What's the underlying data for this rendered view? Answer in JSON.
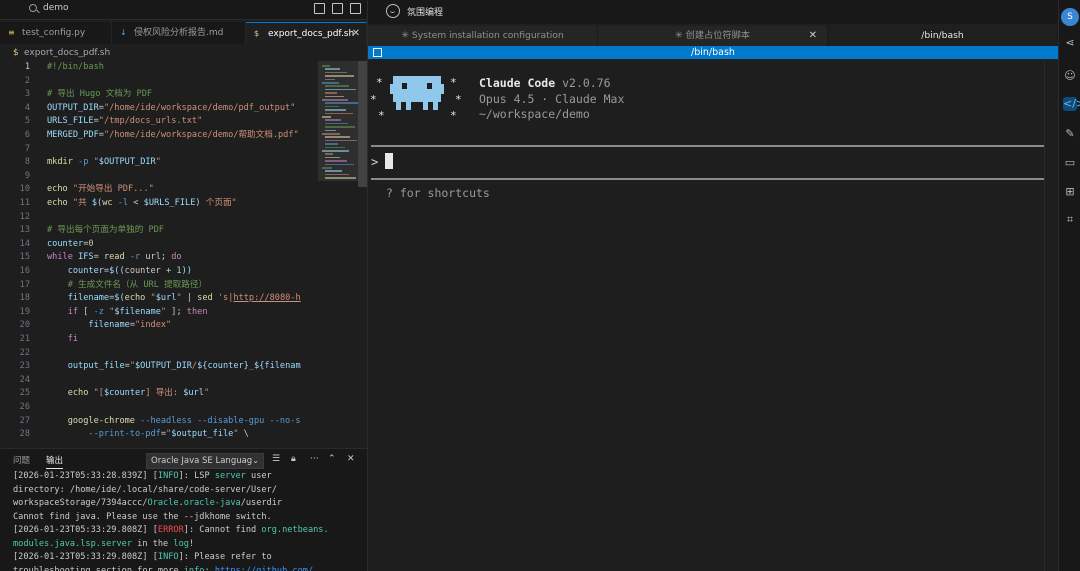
{
  "editor": {
    "window_title": "demo",
    "tabs": [
      {
        "label": "test_config.py",
        "icon": "python-file-icon"
      },
      {
        "label": "侵权风险分析报告.md",
        "icon": "markdown-file-icon"
      },
      {
        "label": "export_docs_pdf.sh",
        "icon": "shell-file-icon",
        "active": true
      }
    ],
    "breadcrumb": "export_docs_pdf.sh",
    "code_lines": [
      {
        "n": "1",
        "html": "<span class='c-com'>#!/bin/bash</span>"
      },
      {
        "n": "2",
        "html": ""
      },
      {
        "n": "3",
        "html": "<span class='c-com'># 导出 Hugo 文档为 PDF</span>"
      },
      {
        "n": "4",
        "html": "<span class='c-var'>OUTPUT_DIR</span>=<span class='c-str'>\"/home/ide/workspace/demo/pdf_output\"</span>"
      },
      {
        "n": "5",
        "html": "<span class='c-var'>URLS_FILE</span>=<span class='c-str'>\"/tmp/docs_urls.txt\"</span>"
      },
      {
        "n": "6",
        "html": "<span class='c-var'>MERGED_PDF</span>=<span class='c-str'>\"/home/ide/workspace/demo/帮助文档.pdf\"</span>"
      },
      {
        "n": "7",
        "html": ""
      },
      {
        "n": "8",
        "html": "<span class='c-fn'>mkdir</span> <span class='c-blue'>-p</span> <span class='c-str'>\"</span><span class='c-var'>$OUTPUT_DIR</span><span class='c-str'>\"</span>"
      },
      {
        "n": "9",
        "html": ""
      },
      {
        "n": "10",
        "html": "<span class='c-fn'>echo</span> <span class='c-str'>\"开始导出 PDF...\"</span>"
      },
      {
        "n": "11",
        "html": "<span class='c-fn'>echo</span> <span class='c-str'>\"共 </span><span class='c-var'>$(</span><span class='c-fn'>wc</span> <span class='c-blue'>-l</span> &lt; <span class='c-var'>$URLS_FILE</span><span class='c-var'>)</span><span class='c-str'> 个页面\"</span>"
      },
      {
        "n": "12",
        "html": ""
      },
      {
        "n": "13",
        "html": "<span class='c-com'># 导出每个页面为单独的 PDF</span>"
      },
      {
        "n": "14",
        "html": "<span class='c-var'>counter</span>=<span class='c-num'>0</span>"
      },
      {
        "n": "15",
        "html": "<span class='c-kw'>while</span> <span class='c-var'>IFS</span>= <span class='c-fn'>read</span> <span class='c-blue'>-r</span> url; <span class='c-kw'>do</span>"
      },
      {
        "n": "16",
        "html": "    <span class='c-var'>counter</span>=<span class='c-var'>$((</span>counter + <span class='c-num'>1</span><span class='c-var'>))</span>"
      },
      {
        "n": "17",
        "html": "    <span class='c-com'># 生成文件名（从 URL 提取路径）</span>"
      },
      {
        "n": "18",
        "html": "    <span class='c-var'>filename</span>=<span class='c-var'>$(</span><span class='c-fn'>echo</span> <span class='c-str'>\"</span><span class='c-var'>$url</span><span class='c-str'>\"</span> | <span class='c-fn'>sed</span> <span class='c-str'>'s|<u>http://8080-h</u></span>"
      },
      {
        "n": "19",
        "html": "    <span class='c-kw'>if</span> [ <span class='c-blue'>-z</span> <span class='c-str'>\"</span><span class='c-var'>$filename</span><span class='c-str'>\"</span> ]; <span class='c-kw'>then</span>"
      },
      {
        "n": "20",
        "html": "        <span class='c-var'>filename</span>=<span class='c-str'>\"index\"</span>"
      },
      {
        "n": "21",
        "html": "    <span class='c-kw'>fi</span>"
      },
      {
        "n": "22",
        "html": ""
      },
      {
        "n": "23",
        "html": "    <span class='c-var'>output_file</span>=<span class='c-str'>\"</span><span class='c-var'>$OUTPUT_DIR</span><span class='c-str'>/</span><span class='c-var'>${counter}</span><span class='c-str'>_</span><span class='c-var'>${filenam</span>"
      },
      {
        "n": "24",
        "html": ""
      },
      {
        "n": "25",
        "html": "    <span class='c-fn'>echo</span> <span class='c-str'>\"[</span><span class='c-var'>$counter</span><span class='c-str'>] 导出: </span><span class='c-var'>$url</span><span class='c-str'>\"</span>"
      },
      {
        "n": "26",
        "html": ""
      },
      {
        "n": "27",
        "html": "    <span class='c-fn'>google-chrome</span> <span class='c-blue'>--headless --disable-gpu --no-s</span>"
      },
      {
        "n": "28",
        "html": "        <span class='c-blue'>--print-to-pdf</span>=<span class='c-str'>\"</span><span class='c-var'>$output_file</span><span class='c-str'>\"</span> \\"
      }
    ],
    "current_line": "1"
  },
  "panel": {
    "tabs": [
      "问题",
      "输出"
    ],
    "active_tab": "输出",
    "channel": "Oracle Java SE Languag",
    "log_html": [
      "<span class='lg-ts'>[2026-01-23T05:33:28.839Z]</span> [<span class='lg-info'>INFO</span>]: LSP <span class='lg-mod'>server</span> user",
      "directory: /home/ide/.local/share/code-server/User/",
      "workspaceStorage/7394accc/<span class='lg-mod'>Oracle</span>.<span class='lg-mod'>oracle-java</span>/userdir",
      "Cannot find java. Please use the --jdkhome switch.",
      "<span class='lg-ts'>[2026-01-23T05:33:29.808Z]</span> [<span class='lg-err'>ERROR</span>]: Cannot find <span class='lg-mod'>org.netbeans.</span>",
      "<span class='lg-mod'>modules.java.lsp.server</span> in the <span class='lg-mod'>log</span>!",
      "<span class='lg-ts'>[2026-01-23T05:33:29.808Z]</span> [<span class='lg-info'>INFO</span>]: Please refer to",
      "troubleshooting section for more <span class='lg-mod'>info</span>: <span class='lg-link'>https://github.com/</span>"
    ]
  },
  "terminal": {
    "app_name": "氛围编程",
    "tabs": [
      {
        "label": "✳ System installation configuration"
      },
      {
        "label": "✳ 创建占位符脚本",
        "closable": true
      },
      {
        "label": "/bin/bash",
        "active": true
      }
    ],
    "title": "/bin/bash",
    "product": "Claude Code",
    "version": "v2.0.76",
    "model_line": "Opus 4.5 · Claude Max",
    "cwd": "~/workspace/demo",
    "prompt": ">",
    "hint": "? for shortcuts"
  },
  "activity": {
    "avatar_letter": "S",
    "icons": [
      "share-icon",
      "robot-icon",
      "code-icon",
      "edit-icon",
      "folder-icon",
      "grid-icon",
      "crop-icon"
    ]
  },
  "colors": {
    "accent": "#007acc",
    "mascot": "#8fc8ea",
    "error": "#f14c4c",
    "info": "#4ec9b0"
  }
}
